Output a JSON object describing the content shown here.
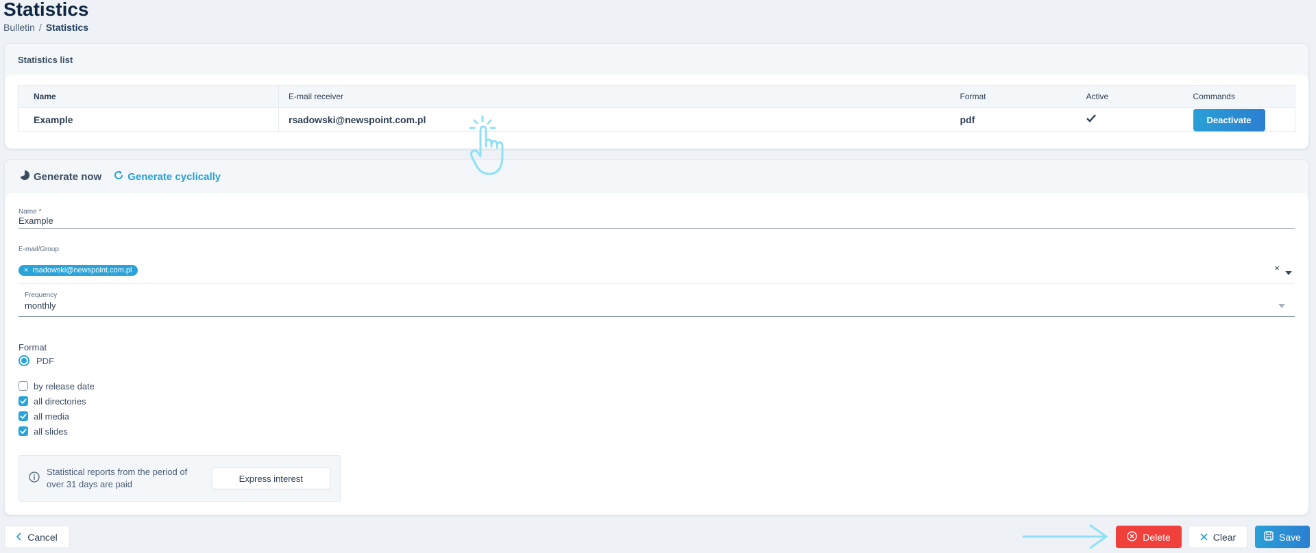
{
  "page": {
    "title": "Statistics",
    "breadcrumb": [
      "Bulletin",
      "Statistics"
    ],
    "breadcrumb_separator": "/"
  },
  "list": {
    "header": "Statistics list",
    "columns": [
      "Name",
      "E-mail receiver",
      "Format",
      "Active",
      "Commands"
    ],
    "rows": [
      {
        "name": "Example",
        "email": "rsadowski@newspoint.com.pl",
        "format": "pdf",
        "active": true,
        "command": "Deactivate"
      }
    ]
  },
  "generate": {
    "tab_now": "Generate now",
    "tab_cyclic": "Generate cyclically",
    "name_label": "Name *",
    "name_value": "Example",
    "email_label": "E-mail/Group",
    "email_chip": "rsadowski@newspoint.com.pl",
    "chip_remove": "×",
    "clear_symbol": "×",
    "frequency_label": "Frequency",
    "frequency_value": "monthly",
    "format_label": "Format",
    "format_option": "PDF",
    "checkboxes": [
      {
        "label": "by release date",
        "checked": false
      },
      {
        "label": "all directories",
        "checked": true
      },
      {
        "label": "all media",
        "checked": true
      },
      {
        "label": "all slides",
        "checked": true
      }
    ],
    "info_text": "Statistical reports from the period of over 31 days are paid",
    "interest_button": "Express interest"
  },
  "actions": {
    "cancel": "Cancel",
    "delete": "Delete",
    "clear": "Clear",
    "save": "Save"
  },
  "colors": {
    "accent": "#2aa3d9",
    "danger": "#f0403c",
    "background": "#eef2f6"
  }
}
